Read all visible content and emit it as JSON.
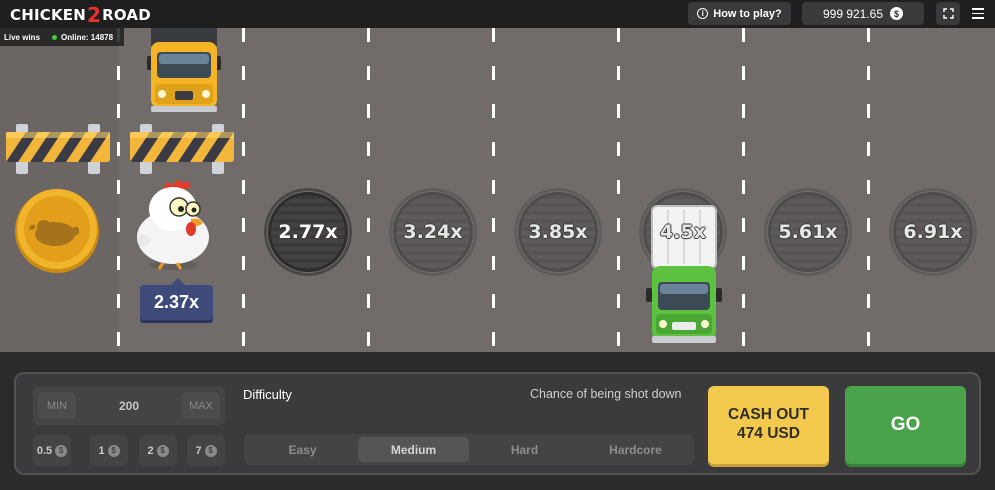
{
  "header": {
    "logo_left": "CHICKEN",
    "logo_mid": "2",
    "logo_right": "ROAD",
    "how_to_play": "How to play?",
    "balance": "999 921.65",
    "currency_symbol": "$"
  },
  "live": {
    "label": "Live wins",
    "online": "Online: 14878"
  },
  "road": {
    "multipliers": [
      "2.77x",
      "3.24x",
      "3.85x",
      "4.5x",
      "5.61x",
      "6.91x"
    ],
    "current_multiplier": "2.37x"
  },
  "controls": {
    "min_label": "MIN",
    "bet_value": "200",
    "max_label": "MAX",
    "quick_bets": [
      "0.5",
      "1",
      "2",
      "7"
    ],
    "difficulty_label": "Difficulty",
    "chance_label": "Chance of being shot down",
    "difficulty_options": [
      "Easy",
      "Medium",
      "Hard",
      "Hardcore"
    ],
    "selected_difficulty": "Medium",
    "cashout_line1": "CASH OUT",
    "cashout_line2": "474 USD",
    "go_label": "GO"
  },
  "colors": {
    "road": "#716c6a",
    "go": "#4aa24a",
    "cashout": "#f2c94c",
    "badge": "#3d4a7a"
  }
}
